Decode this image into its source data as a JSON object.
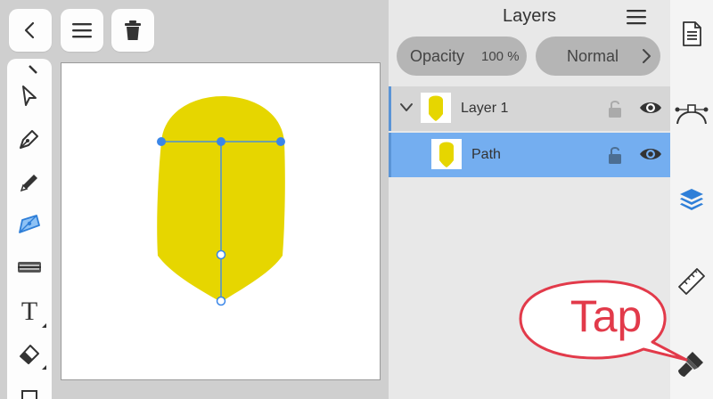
{
  "toolbar_top": {
    "back_icon": "chevron-left-icon",
    "menu_icon": "hamburger-icon",
    "delete_icon": "trash-icon"
  },
  "tools": [
    "node-select-icon",
    "pointer-icon",
    "pen-icon",
    "pencil-icon",
    "shape-fill-icon",
    "ruler-blend-icon",
    "text-icon",
    "eraser-icon"
  ],
  "tools_text": {
    "text_tool_glyph": "T"
  },
  "canvas": {
    "shape_color": "#e6d600",
    "handle_color": "#3a86e8"
  },
  "layers_panel": {
    "title": "Layers",
    "opacity_label": "Opacity",
    "opacity_value": "100 %",
    "blend_mode": "Normal",
    "layers": [
      {
        "name": "Layer 1",
        "expanded": true,
        "locked": false,
        "visible": true
      },
      {
        "name": "Path",
        "selected": true,
        "locked": false,
        "visible": true
      }
    ]
  },
  "right_strip": {
    "icons": [
      "document-icon",
      "bezier-path-icon",
      "layers-stack-icon",
      "ruler-icon",
      "brush-icon"
    ]
  },
  "callout": {
    "text": "Tap",
    "color": "#e23a4a"
  },
  "colors": {
    "selection_blue": "#74aef0",
    "accent_blue": "#3a86e8"
  }
}
